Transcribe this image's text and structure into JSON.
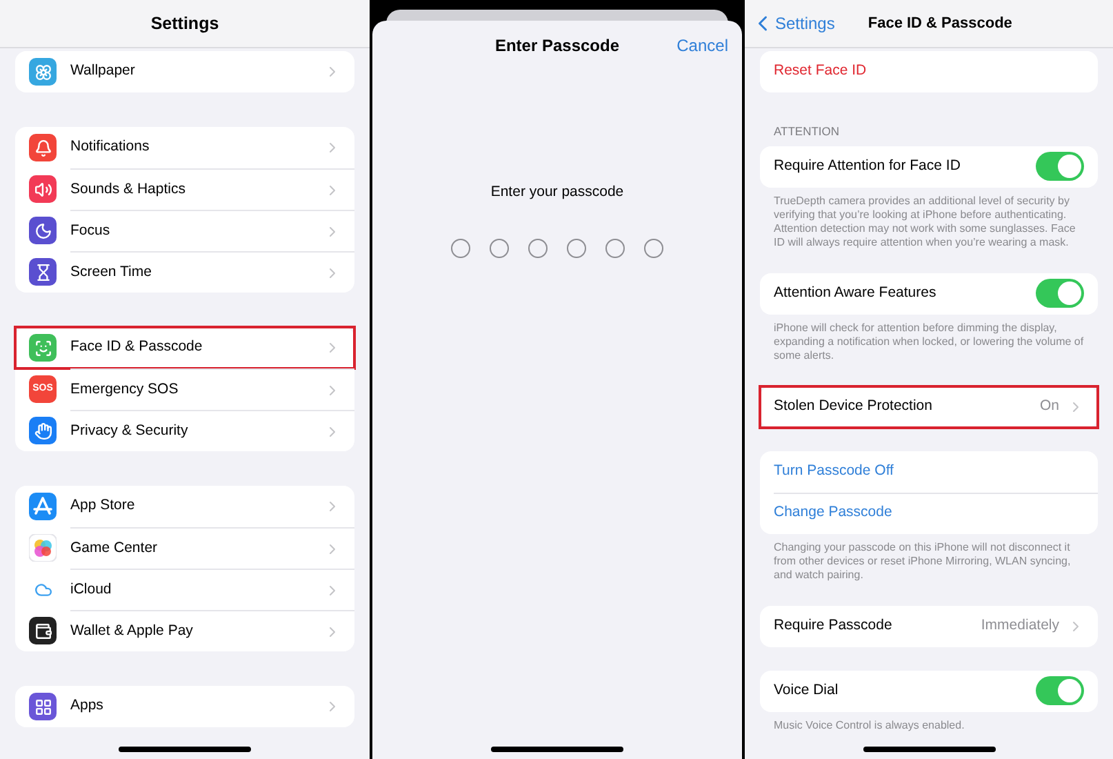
{
  "settings_panel": {
    "title": "Settings",
    "groups": [
      {
        "items": [
          {
            "label": "Wallpaper",
            "highlighted": false
          }
        ]
      },
      {
        "items": [
          {
            "label": "Notifications",
            "highlighted": false
          },
          {
            "label": "Sounds & Haptics",
            "highlighted": false
          },
          {
            "label": "Focus",
            "highlighted": false
          },
          {
            "label": "Screen Time",
            "highlighted": false
          }
        ]
      },
      {
        "items": [
          {
            "label": "Face ID & Passcode",
            "highlighted": true
          },
          {
            "label": "Emergency SOS",
            "badge": "SOS",
            "highlighted": false
          },
          {
            "label": "Privacy & Security",
            "highlighted": false
          }
        ]
      },
      {
        "items": [
          {
            "label": "App Store",
            "highlighted": false
          },
          {
            "label": "Game Center",
            "highlighted": false
          },
          {
            "label": "iCloud",
            "highlighted": false
          },
          {
            "label": "Wallet & Apple Pay",
            "highlighted": false
          }
        ]
      },
      {
        "items": [
          {
            "label": "Apps",
            "highlighted": false
          }
        ]
      }
    ]
  },
  "passcode_sheet": {
    "title": "Enter Passcode",
    "cancel": "Cancel",
    "prompt": "Enter your passcode",
    "dots": [
      {
        "filled": false
      },
      {
        "filled": false
      },
      {
        "filled": false
      },
      {
        "filled": false
      },
      {
        "filled": false
      },
      {
        "filled": false
      }
    ]
  },
  "faceid_panel": {
    "back": "Settings",
    "title": "Face ID & Passcode",
    "sections": [
      {
        "rows": [
          {
            "kind": "destructive",
            "label": "Reset Face ID",
            "highlighted": false
          }
        ]
      },
      {
        "header": "ATTENTION",
        "rows": [
          {
            "kind": "toggle",
            "label": "Require Attention for Face ID",
            "on": true,
            "highlighted": false
          }
        ],
        "footer": "TrueDepth camera provides an additional level of security by verifying that you’re looking at iPhone before authenticating. Attention detection may not work with some sunglasses. Face ID will always require attention when you’re wearing a mask."
      },
      {
        "rows": [
          {
            "kind": "toggle",
            "label": "Attention Aware Features",
            "on": true,
            "highlighted": false
          }
        ],
        "footer": "iPhone will check for attention before dimming the display, expanding a notification when locked, or lowering the volume of some alerts."
      },
      {
        "rows": [
          {
            "kind": "nav",
            "label": "Stolen Device Protection",
            "value": "On",
            "highlighted": true
          }
        ]
      },
      {
        "rows": [
          {
            "kind": "action",
            "label": "Turn Passcode Off",
            "highlighted": false
          },
          {
            "kind": "action",
            "label": "Change Passcode",
            "highlighted": false
          }
        ],
        "footer": "Changing your passcode on this iPhone will not disconnect it from other devices or reset iPhone Mirroring, WLAN syncing, and watch pairing."
      },
      {
        "rows": [
          {
            "kind": "nav",
            "label": "Require Passcode",
            "value": "Immediately",
            "highlighted": false
          }
        ]
      },
      {
        "rows": [
          {
            "kind": "toggle",
            "label": "Voice Dial",
            "on": true,
            "highlighted": false
          }
        ],
        "footer": "Music Voice Control is always enabled."
      }
    ]
  }
}
